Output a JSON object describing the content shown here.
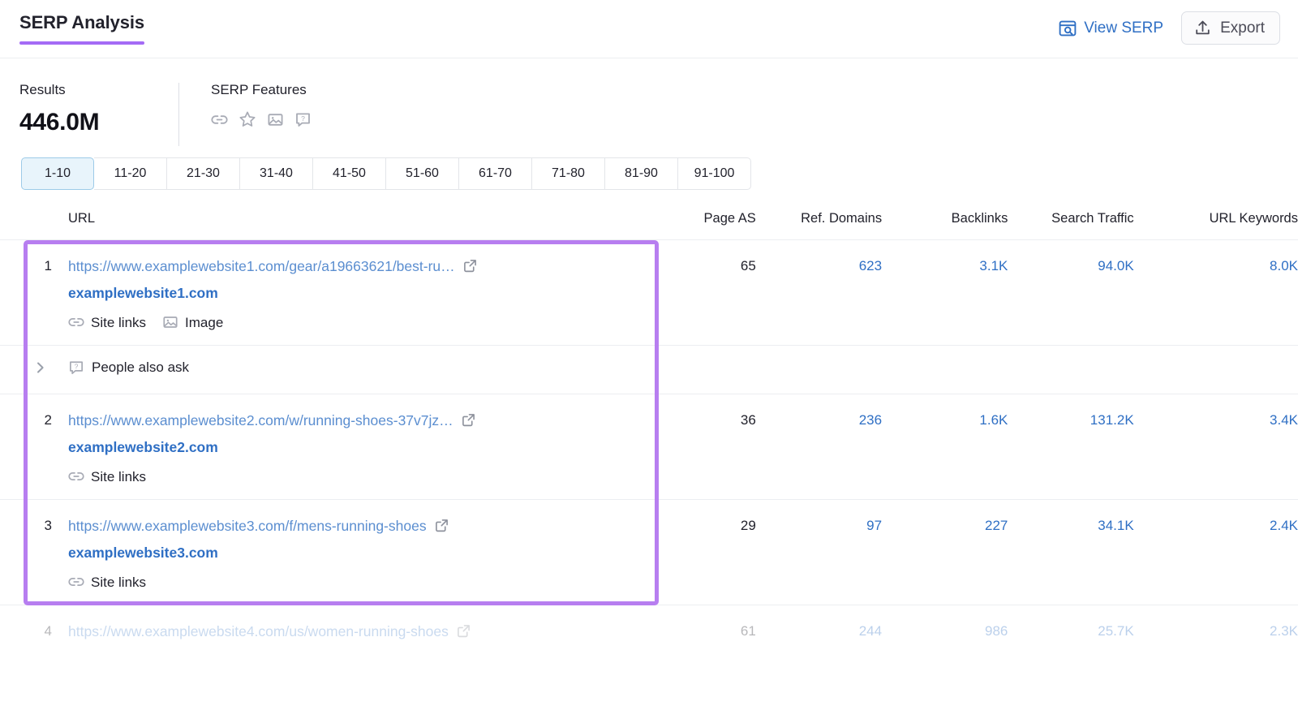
{
  "header": {
    "title": "SERP Analysis",
    "accent_color": "#a46bf5",
    "view_serp_label": "View SERP",
    "export_label": "Export"
  },
  "summary": {
    "results_label": "Results",
    "results_value": "446.0M",
    "features_label": "SERP Features",
    "feature_icons": [
      "sitelinks-icon",
      "reviews-star-icon",
      "image-icon",
      "people-also-ask-icon"
    ]
  },
  "pagination": {
    "active_index": 0,
    "tabs": [
      "1-10",
      "11-20",
      "21-30",
      "31-40",
      "41-50",
      "51-60",
      "61-70",
      "71-80",
      "81-90",
      "91-100"
    ]
  },
  "table": {
    "columns": [
      "URL",
      "Page AS",
      "Ref. Domains",
      "Backlinks",
      "Search Traffic",
      "URL Keywords"
    ],
    "rows": [
      {
        "type": "result",
        "rank": "1",
        "url": "https://www.examplewebsite1.com/gear/a19663621/best-ru…",
        "domain": "examplewebsite1.com",
        "features": [
          {
            "icon": "sitelinks-icon",
            "label": "Site links"
          },
          {
            "icon": "image-icon",
            "label": "Image"
          }
        ],
        "page_as": "65",
        "ref_domains": "623",
        "backlinks": "3.1K",
        "search_traffic": "94.0K",
        "url_keywords": "8.0K"
      },
      {
        "type": "paa",
        "icon": "people-also-ask-icon",
        "label": "People also ask",
        "expand_icon": "chevron-right-icon"
      },
      {
        "type": "result",
        "rank": "2",
        "url": "https://www.examplewebsite2.com/w/running-shoes-37v7jz…",
        "domain": "examplewebsite2.com",
        "features": [
          {
            "icon": "sitelinks-icon",
            "label": "Site links"
          }
        ],
        "page_as": "36",
        "ref_domains": "236",
        "backlinks": "1.6K",
        "search_traffic": "131.2K",
        "url_keywords": "3.4K"
      },
      {
        "type": "result",
        "rank": "3",
        "url": "https://www.examplewebsite3.com/f/mens-running-shoes",
        "domain": "examplewebsite3.com",
        "features": [
          {
            "icon": "sitelinks-icon",
            "label": "Site links"
          }
        ],
        "page_as": "29",
        "ref_domains": "97",
        "backlinks": "227",
        "search_traffic": "34.1K",
        "url_keywords": "2.4K"
      },
      {
        "type": "result-faded",
        "rank": "4",
        "url": "https://www.examplewebsite4.com/us/women-running-shoes",
        "domain": "",
        "features": [],
        "page_as": "61",
        "ref_domains": "244",
        "backlinks": "986",
        "search_traffic": "25.7K",
        "url_keywords": "2.3K"
      }
    ]
  },
  "highlight": {
    "color": "#b77ef0",
    "covers_rows": "1-3"
  }
}
